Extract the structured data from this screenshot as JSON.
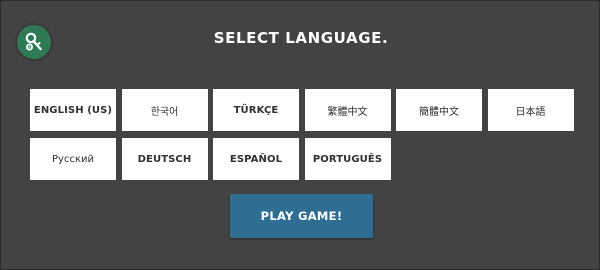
{
  "title": "SELECT LANGUAGE.",
  "settings_icon": "key-and-gear-icon",
  "languages": [
    {
      "label": "ENGLISH (US)",
      "style": "latin"
    },
    {
      "label": "한국어",
      "style": "native"
    },
    {
      "label": "TÜRKÇE",
      "style": "latin"
    },
    {
      "label": "繁體中文",
      "style": "native"
    },
    {
      "label": "簡體中文",
      "style": "native"
    },
    {
      "label": "日本語",
      "style": "native"
    },
    {
      "label": "Русский",
      "style": "native"
    },
    {
      "label": "DEUTSCH",
      "style": "latin"
    },
    {
      "label": "ESPAÑOL",
      "style": "latin"
    },
    {
      "label": "PORTUGUÊS",
      "style": "latin"
    }
  ],
  "play_button": "PLAY GAME!",
  "colors": {
    "background": "#434343",
    "icon_green": "#2f7a55",
    "play_blue": "#2f6d92",
    "tile": "#ffffff",
    "tile_text": "#303030"
  }
}
